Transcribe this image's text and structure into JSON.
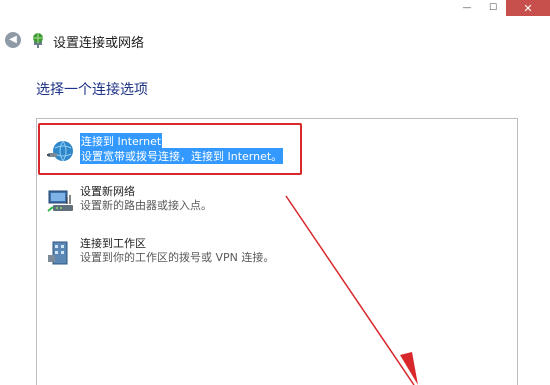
{
  "window": {
    "minimize_glyph": "—",
    "maximize_glyph": "☐",
    "close_glyph": "✕"
  },
  "header": {
    "back_icon": "back-arrow-icon",
    "title_icon": "network-setup-icon",
    "title": "设置连接或网络"
  },
  "heading": "选择一个连接选项",
  "options": [
    {
      "icon": "globe-connect-icon",
      "title": "连接到 Internet",
      "description": "设置宽带或拨号连接，连接到 Internet。",
      "selected": true
    },
    {
      "icon": "new-network-icon",
      "title": "设置新网络",
      "description": "设置新的路由器或接入点。",
      "selected": false
    },
    {
      "icon": "workplace-connect-icon",
      "title": "连接到工作区",
      "description": "设置到你的工作区的拨号或 VPN 连接。",
      "selected": false
    }
  ],
  "colors": {
    "selection": "#3399ff",
    "heading": "#1e3287",
    "highlight_box": "#d8282c",
    "close_button": "#c7504c"
  }
}
